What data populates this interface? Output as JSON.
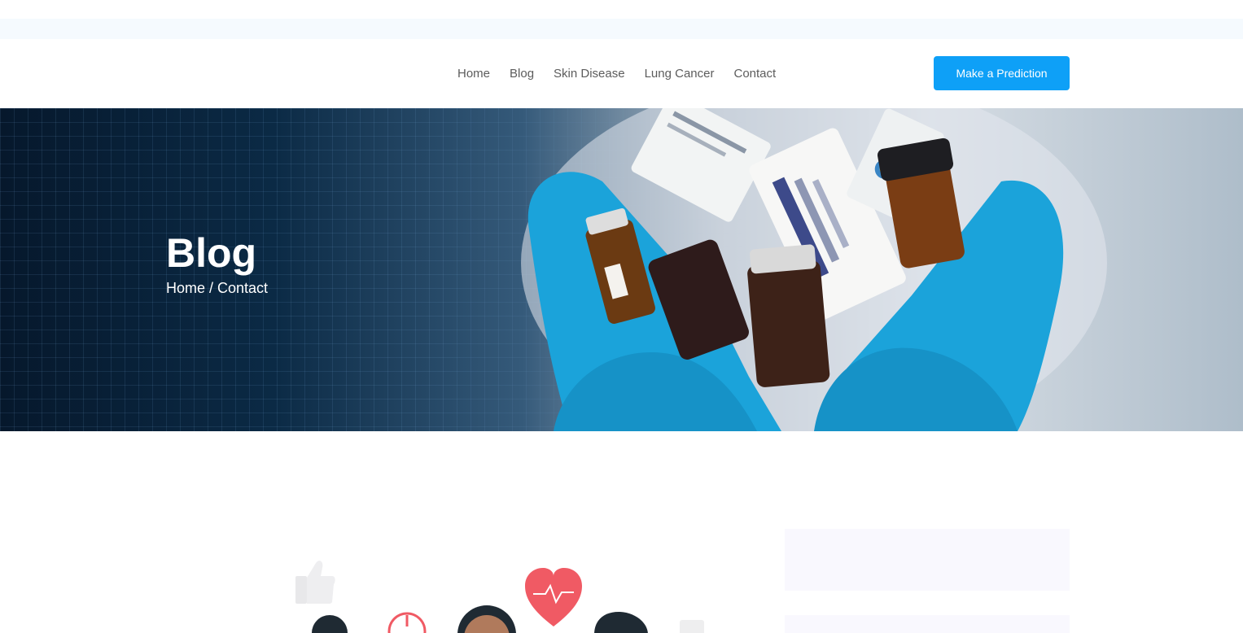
{
  "nav": {
    "links": [
      "Home",
      "Blog",
      "Skin Disease",
      "Lung Cancer",
      "Contact"
    ],
    "cta_label": "Make a Prediction"
  },
  "hero": {
    "title": "Blog",
    "breadcrumb": "Home / Contact"
  },
  "colors": {
    "accent": "#0ea0f7",
    "hero_dark": "#06182c",
    "glove_blue": "#1aa3d9",
    "heart_red": "#f05a64"
  },
  "icons": [
    "thumbs-up-icon",
    "heart-pulse-icon"
  ]
}
